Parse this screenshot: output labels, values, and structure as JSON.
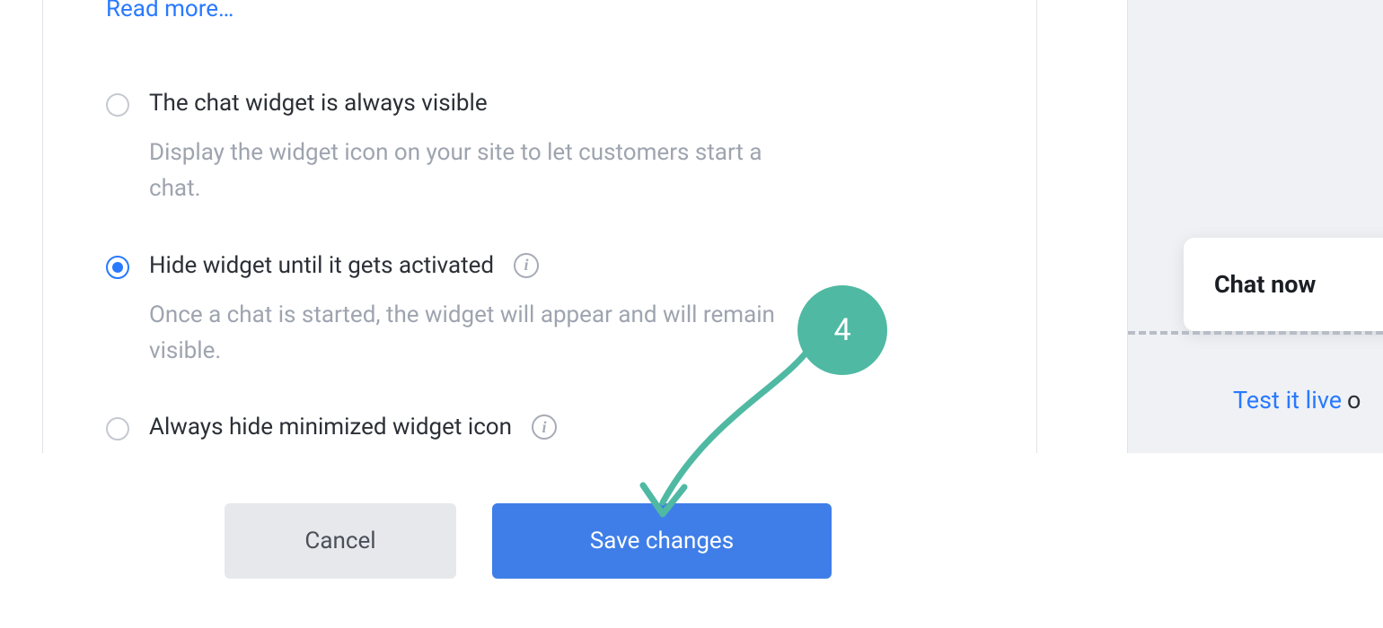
{
  "header": {
    "read_more": "Read more…"
  },
  "options": [
    {
      "title": "The chat widget is always visible",
      "desc": "Display the widget icon on your site to let customers start a chat.",
      "has_info": false,
      "selected": false
    },
    {
      "title": "Hide widget until it gets activated",
      "desc": "Once a chat is started, the widget will appear and will remain visible.",
      "has_info": true,
      "selected": true
    },
    {
      "title": "Always hide minimized widget icon",
      "desc": "",
      "has_info": true,
      "selected": false
    }
  ],
  "buttons": {
    "cancel": "Cancel",
    "save": "Save changes"
  },
  "preview": {
    "chat_label": "Chat now",
    "test_link": "Test it live",
    "test_suffix": "o"
  },
  "annotation": {
    "step": "4"
  },
  "colors": {
    "link": "#2979ff",
    "text": "#2b2f36",
    "muted": "#9ea4af",
    "accent": "#4fb9a3",
    "primary_btn": "#3f7ee8"
  }
}
